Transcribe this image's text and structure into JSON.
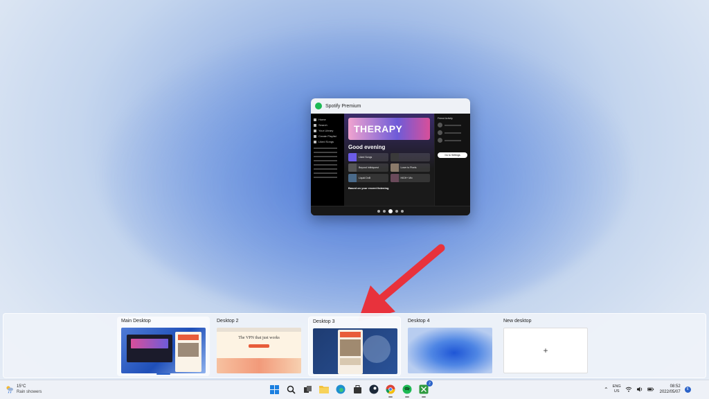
{
  "window_preview": {
    "title": "Spotify Premium",
    "sidebar_nav": [
      "Home",
      "Search",
      "Your Library",
      "Create Playlist",
      "Liked Songs"
    ],
    "banner_text": "THERAPY",
    "greeting": "Good evening",
    "tiles": [
      "Liked Songs",
      "",
      "Beyond Infiniquest",
      "Lover to Pixels",
      "Liquid DnB",
      "HIGH+ Mix"
    ],
    "section_title": "Based on your recent listening",
    "activity_title": "Friend Activity",
    "settings_button": "Go to Settings"
  },
  "task_view": {
    "desktops": [
      {
        "label": "Main Desktop"
      },
      {
        "label": "Desktop 2"
      },
      {
        "label": "Desktop 3"
      },
      {
        "label": "Desktop 4"
      },
      {
        "label": "New desktop"
      }
    ],
    "new_desktop_icon": "plus-icon",
    "d2_headline": "The VPN that just works"
  },
  "taskbar": {
    "weather": {
      "temp": "15°C",
      "condition": "Rain showers",
      "icon": "weather-sun-rain-icon"
    },
    "apps": [
      {
        "name": "start-icon",
        "running": false
      },
      {
        "name": "search-icon",
        "running": false
      },
      {
        "name": "task-view-icon",
        "running": false
      },
      {
        "name": "file-explorer-icon",
        "running": false
      },
      {
        "name": "edge-icon",
        "running": false
      },
      {
        "name": "store-icon",
        "running": false
      },
      {
        "name": "steam-icon",
        "running": false
      },
      {
        "name": "chrome-icon",
        "running": true
      },
      {
        "name": "spotify-icon",
        "running": true
      },
      {
        "name": "xbox-icon",
        "badge": "2",
        "running": true
      }
    ],
    "tray": {
      "lang_top": "ENG",
      "lang_bottom": "US"
    },
    "clock": {
      "time": "08:52",
      "date": "2022/05/07"
    },
    "notification_count": "6"
  },
  "colors": {
    "accent": "#2a62c8",
    "arrow": "#e8323c",
    "spotify_green": "#1db954"
  }
}
